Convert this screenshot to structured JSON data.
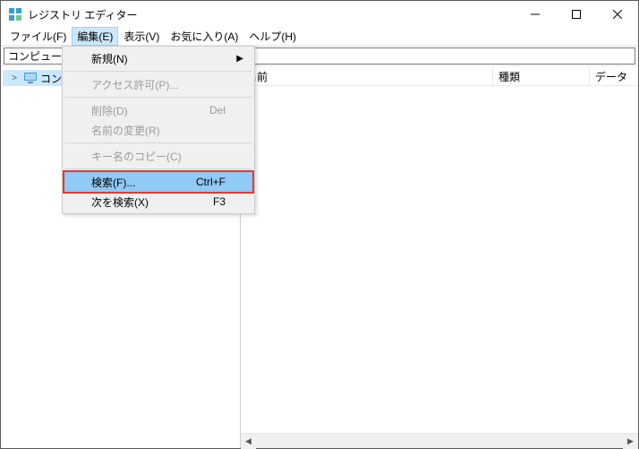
{
  "window": {
    "title": "レジストリ エディター"
  },
  "menubar": {
    "items": [
      {
        "label": "ファイル(F)"
      },
      {
        "label": "編集(E)"
      },
      {
        "label": "表示(V)"
      },
      {
        "label": "お気に入り(A)"
      },
      {
        "label": "ヘルプ(H)"
      }
    ]
  },
  "addressbar": {
    "value": "コンピューター"
  },
  "tree": {
    "root": {
      "label": "コンピューター"
    }
  },
  "columns": {
    "name": "名前",
    "type": "種類",
    "data": "データ"
  },
  "editmenu": {
    "new": {
      "label": "新規(N)"
    },
    "perm": {
      "label": "アクセス許可(P)..."
    },
    "delete": {
      "label": "削除(D)",
      "shortcut": "Del"
    },
    "rename": {
      "label": "名前の変更(R)"
    },
    "copykey": {
      "label": "キー名のコピー(C)"
    },
    "find": {
      "label": "検索(F)...",
      "shortcut": "Ctrl+F"
    },
    "findnext": {
      "label": "次を検索(X)",
      "shortcut": "F3"
    }
  }
}
